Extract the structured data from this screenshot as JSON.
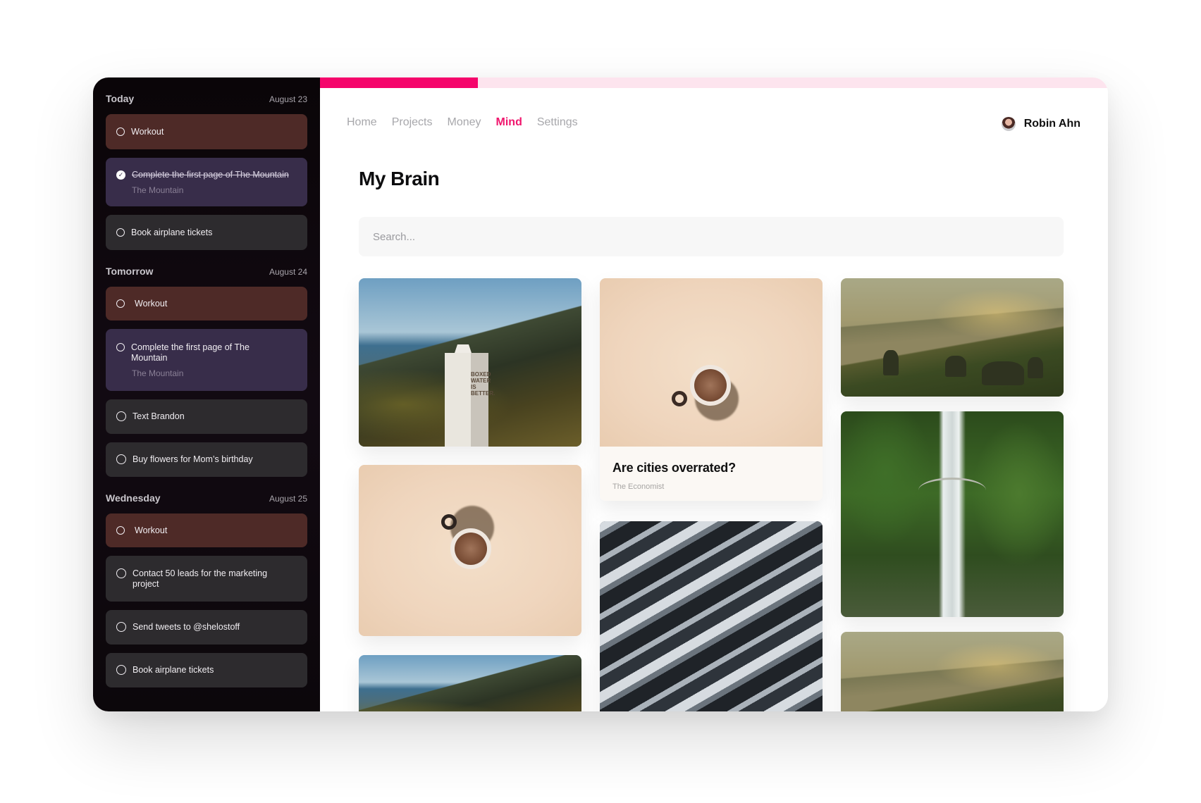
{
  "sidebar": {
    "sections": [
      {
        "title": "Today",
        "date": "August 23",
        "tasks": [
          {
            "label": "Workout"
          },
          {
            "label": "Complete the first page of The Mountain",
            "sub": "The Mountain"
          },
          {
            "label": "Book airplane tickets"
          }
        ]
      },
      {
        "title": "Tomorrow",
        "date": "August 24",
        "tasks": [
          {
            "label": "Workout"
          },
          {
            "label": "Complete the first page of The Mountain",
            "sub": "The Mountain"
          },
          {
            "label": "Text Brandon"
          },
          {
            "label": "Buy flowers for Mom’s birthday"
          }
        ]
      },
      {
        "title": "Wednesday",
        "date": "August 25",
        "tasks": [
          {
            "label": "Workout"
          },
          {
            "label": "Contact 50 leads for the marketing project"
          },
          {
            "label": "Send tweets to @shelostoff"
          },
          {
            "label": "Book airplane tickets"
          }
        ]
      }
    ]
  },
  "progress": {
    "fraction": 0.2
  },
  "nav": {
    "items": [
      "Home",
      "Projects",
      "Money",
      "Mind",
      "Settings"
    ],
    "active": "Mind"
  },
  "user": {
    "name": "Robin Ahn"
  },
  "main": {
    "title": "My Brain",
    "search_placeholder": "Search..."
  },
  "cards": {
    "article": {
      "title": "Are cities overrated?",
      "source": "The Economist"
    },
    "milk_carton_text": "BOXED WATER IS BETTER."
  },
  "colors": {
    "accent": "#f0166d",
    "progress_fill": "#f5056b",
    "progress_track": "#fde4ee",
    "task_brown": "#4e2a27",
    "task_purple": "#382d4a",
    "task_gray": "#2d2b2e"
  },
  "icons": {
    "task_open": "circle-icon",
    "task_done": "check-circle-icon",
    "avatar": "avatar"
  }
}
